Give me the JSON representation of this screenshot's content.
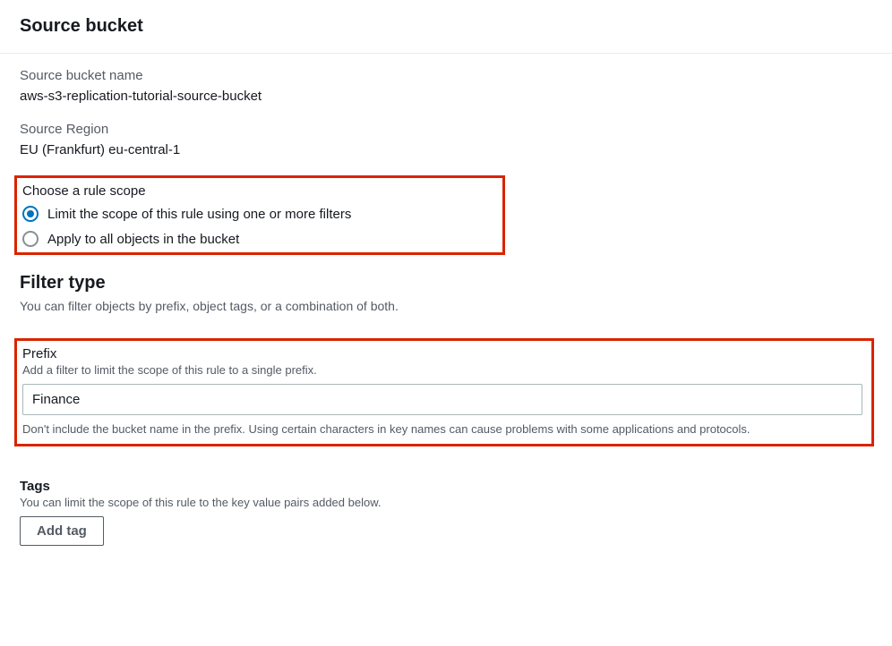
{
  "header": {
    "title": "Source bucket"
  },
  "source_bucket_name": {
    "label": "Source bucket name",
    "value": "aws-s3-replication-tutorial-source-bucket"
  },
  "source_region": {
    "label": "Source Region",
    "value": "EU (Frankfurt) eu-central-1"
  },
  "rule_scope": {
    "label": "Choose a rule scope",
    "options": [
      {
        "label": "Limit the scope of this rule using one or more filters",
        "selected": true
      },
      {
        "label": "Apply to all objects in the bucket",
        "selected": false
      }
    ]
  },
  "filter_type": {
    "heading": "Filter type",
    "description": "You can filter objects by prefix, object tags, or a combination of both."
  },
  "prefix": {
    "label": "Prefix",
    "description": "Add a filter to limit the scope of this rule to a single prefix.",
    "value": "Finance",
    "hint": "Don't include the bucket name in the prefix. Using certain characters in key names can cause problems with some applications and protocols."
  },
  "tags": {
    "label": "Tags",
    "description": "You can limit the scope of this rule to the key value pairs added below.",
    "add_button": "Add tag"
  }
}
